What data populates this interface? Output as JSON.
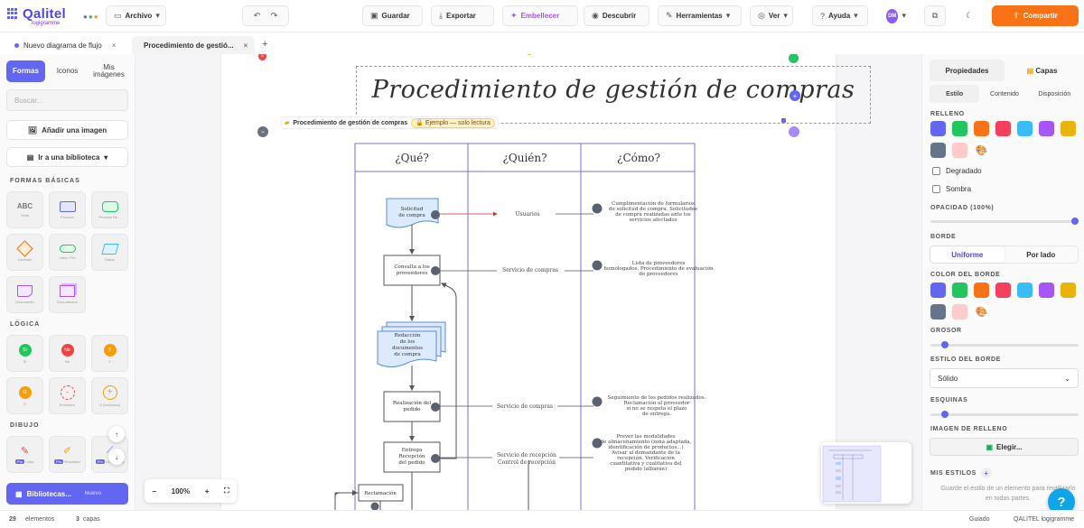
{
  "app": {
    "logo_name": "Qalitel",
    "logo_sub": "logigramme",
    "menu": [
      {
        "label": "Archivo",
        "icon": "file-icon",
        "caret": true
      },
      {
        "label": "",
        "icon": "undo-icon"
      },
      {
        "label": "",
        "icon": "redo-icon"
      },
      {
        "label": "Guardar",
        "icon": "save-icon"
      },
      {
        "label": "Exportar",
        "icon": "export-icon"
      },
      {
        "label": "Embellecer",
        "icon": "sparkle-icon"
      },
      {
        "label": "Descubrir",
        "icon": "compass-icon"
      },
      {
        "label": "Herramientas",
        "icon": "wrench-icon",
        "caret": true
      },
      {
        "label": "Ver",
        "icon": "eye-icon",
        "caret": true
      },
      {
        "label": "Ayuda",
        "icon": "help-icon",
        "caret": true
      }
    ],
    "avatar_initials": "DM",
    "compartir": "Compartir",
    "accent": "#6366f1",
    "orange": "#f97316"
  },
  "tabs": [
    {
      "label": "Nuevo diagrama de flujo",
      "dot": "#6366f1",
      "close": "×"
    },
    {
      "label": "Procedimiento de gestió...",
      "dot": "#22c55e",
      "close": "×"
    }
  ],
  "sidebar": {
    "segments": [
      "Formas",
      "Iconos",
      "Mis imágenes"
    ],
    "search_placeholder": "Buscar...",
    "add_image": "Añadir una imagen",
    "goto_library": "Ir a una biblioteca",
    "section_basic": "FORMAS BÁSICAS",
    "section_logic": "LÓGICA",
    "section_draw": "DIBUJO",
    "basic_shapes": [
      {
        "label": "Texto",
        "glyph": "ABC"
      },
      {
        "label": "Proceso",
        "glyph": ""
      },
      {
        "label": "Proceso Re...",
        "glyph": ""
      },
      {
        "label": "Decisión",
        "glyph": ""
      },
      {
        "label": "Inicio / Fin",
        "glyph": ""
      },
      {
        "label": "Datos",
        "glyph": ""
      },
      {
        "label": "Documento",
        "glyph": ""
      },
      {
        "label": "Documentos",
        "glyph": ""
      }
    ],
    "logic_shapes": [
      {
        "label": "Sí",
        "glyph": "Sí",
        "color": "#22c55e"
      },
      {
        "label": "No",
        "glyph": "No",
        "color": "#ef4444"
      },
      {
        "label": "Y",
        "glyph": "Y",
        "color": "#f59e0b"
      },
      {
        "label": "O",
        "glyph": "O",
        "color": "#f59e0b"
      },
      {
        "label": "Exclusivo",
        "glyph": "",
        "color": "#ef4444"
      },
      {
        "label": "O (exclusivo)",
        "glyph": "",
        "color": "#f59e0b"
      }
    ],
    "draw_tools": [
      {
        "label": "Lápiz",
        "pro": "Pro"
      },
      {
        "label": "Rotulador",
        "pro": "Pro"
      },
      {
        "label": "Línea recta",
        "pro": "Pro"
      }
    ],
    "libraries": "Bibliotecas...",
    "libraries_new": "Nuevo"
  },
  "canvas": {
    "crumb_title": "Procedimiento de gestión de compras",
    "crumb_badge": "Ejemplo — solo lectura",
    "diagram_title": "Procedimiento de gestión de compras",
    "columns": [
      "¿Qué?",
      "¿Quién?",
      "¿Cómo?"
    ],
    "steps": [
      {
        "what": "Solicitud de compra",
        "who": "Usuarios",
        "how": "Cumplimentación de formularios de solicitud de compra. Solicitudes de compra realizadas ante los servicios afectados"
      },
      {
        "what": "Consulta a los proveedores",
        "who": "Servicio de compras",
        "how": "Lista de proveedores homologados. Procedimiento de evaluación de proveedores"
      },
      {
        "what": "Redacción de los documentos de compra",
        "who": "",
        "how": ""
      },
      {
        "what": "Realización del pedido",
        "who": "Servicio de compras",
        "how": "Seguimiento de los pedidos realizados. Reclamación al proveedor si no se respeta el plazo de entrega."
      },
      {
        "what": "Entrega Recepción del pedido",
        "who": "Servicio de recepción Control de recepción",
        "how": "Prever las modalidades de almacenamiento (zona adaptada, identificación de productos...) Avisar al demandante de la recepción. Verificación cuantitativa y cualitativa del pedido (albarán)"
      },
      {
        "what": "Reclamación",
        "who": "",
        "how": ""
      }
    ],
    "zoom": "100%",
    "zoom_minus": "−",
    "zoom_plus": "+"
  },
  "right_panel": {
    "tabs": [
      "Propiedades",
      "Capas"
    ],
    "subtabs": [
      "Estilo",
      "Contenido",
      "Disposición"
    ],
    "fill_label": "RELLENO",
    "fill_colors": [
      "#6366f1",
      "#22c55e",
      "#f97316",
      "#f43f5e",
      "#38bdf8",
      "#a855f7",
      "#eab308",
      "#64748b",
      "#fecaca"
    ],
    "gradient": "Degradado",
    "shadow": "Sombra",
    "opacity_label": "OPACIDAD (100%)",
    "opacity": 1.0,
    "border_label": "BORDE",
    "border_modes": [
      "Uniforme",
      "Por lado"
    ],
    "border_color_label": "COLOR DEL BORDE",
    "border_colors": [
      "#6366f1",
      "#22c55e",
      "#f97316",
      "#f43f5e",
      "#38bdf8",
      "#a855f7",
      "#eab308",
      "#64748b",
      "#fecaca"
    ],
    "thickness_label": "GROSOR",
    "thickness": 0.08,
    "border_style_label": "ESTILO DEL BORDE",
    "border_style": "Sólido",
    "corners_label": "ESQUINAS",
    "corners": 0.08,
    "fill_image_label": "IMAGEN DE RELLENO",
    "choose": "Elegir...",
    "my_styles": "MIS ESTILOS",
    "my_styles_hint": "Guarde el estilo de un elemento para reutilizarlo en todas partes."
  },
  "status": {
    "elements_count": "29",
    "elements_label": "elementos",
    "layers_count": "3",
    "layers_label": "capas",
    "mode": "Guiado",
    "brand": "QALITEL logigramme"
  }
}
